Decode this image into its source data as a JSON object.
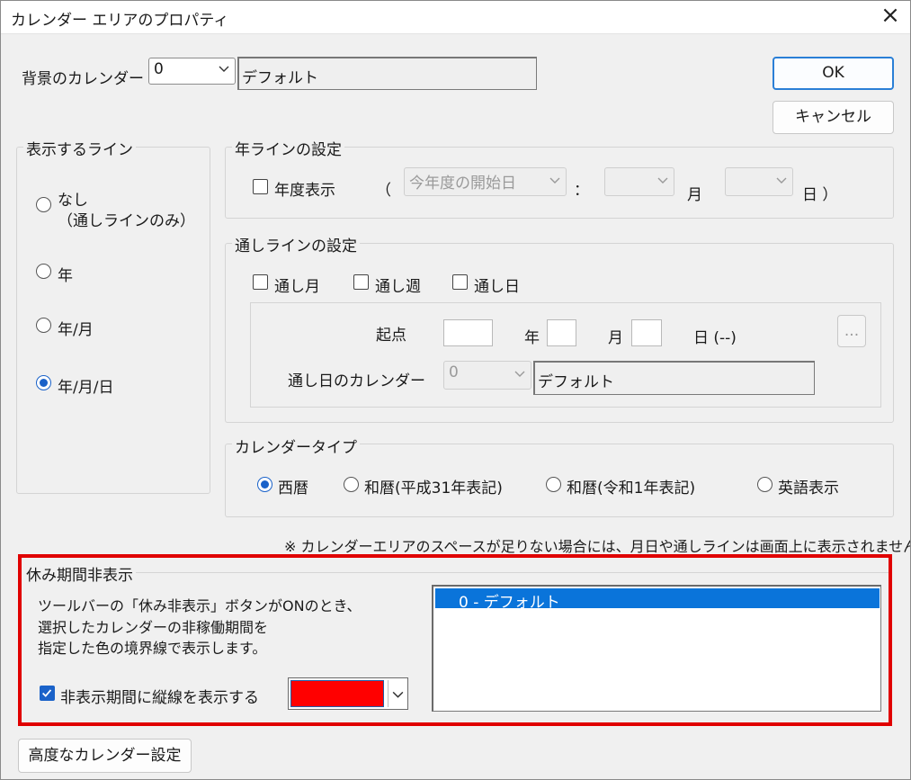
{
  "window": {
    "title": "カレンダー エリアのプロパティ",
    "close_icon": "×"
  },
  "background_calendar": {
    "label": "背景のカレンダー",
    "value": "0",
    "name": "デフォルト"
  },
  "buttons": {
    "ok": "OK",
    "cancel": "キャンセル",
    "advanced": "高度なカレンダー設定",
    "ellipsis": "..."
  },
  "display_line": {
    "title": "表示するライン",
    "options": [
      "なし",
      "（通しラインのみ）",
      "年",
      "年/月",
      "年/月/日"
    ],
    "selected": "年/月/日"
  },
  "year_line": {
    "title": "年ラインの設定",
    "fiscal_label": "年度表示",
    "open_paren": "（",
    "start_value": "今年度の開始日",
    "colon": "：",
    "month_unit": "月",
    "day_unit": "日 ）"
  },
  "through_line": {
    "title": "通しラインの設定",
    "checks": [
      "通し月",
      "通し週",
      "通し日"
    ],
    "start_label": "起点",
    "year_unit": "年",
    "month_unit": "月",
    "day_unit": "日 (--)",
    "calendar_label": "通し日のカレンダー",
    "calendar_value": "0",
    "calendar_name": "デフォルト"
  },
  "calendar_type": {
    "title": "カレンダータイプ",
    "options": [
      "西暦",
      "和暦(平成31年表記)",
      "和暦(令和1年表記)",
      "英語表示"
    ],
    "selected": "西暦"
  },
  "note": "※ カレンダーエリアのスペースが足りない場合には、月日や通しラインは画面上に表示されません。",
  "holiday": {
    "title": "休み期間非表示",
    "desc": [
      "ツールバーの「休み非表示」ボタンがONのとき、",
      "選択したカレンダーの非稼働期間を",
      "指定した色の境界線で表示します。"
    ],
    "check_label": "非表示期間に縦線を表示する",
    "checked": true,
    "color": "#ff0000",
    "list_items": [
      "0 - デフォルト"
    ]
  },
  "colors": {
    "accent": "#1a62c9",
    "highlight": "#e00000",
    "selection": "#0a74da"
  }
}
